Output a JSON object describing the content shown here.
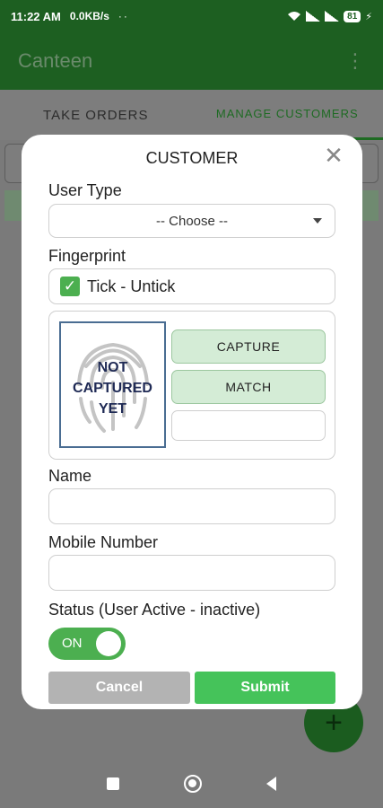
{
  "status_bar": {
    "time": "11:22 AM",
    "speed": "0.0KB/s",
    "dots": "··",
    "battery": "81"
  },
  "app_bar": {
    "title": "Canteen",
    "menu_icon": "more-vert-icon"
  },
  "tabs": [
    {
      "label": "TAKE ORDERS"
    },
    {
      "label": "MANAGE CUSTOMERS",
      "active": true
    }
  ],
  "dialog": {
    "title": "CUSTOMER",
    "close_icon": "close-icon",
    "user_type_label": "User Type",
    "user_type_value": "-- Choose --",
    "fingerprint_label": "Fingerprint",
    "tick_label": "Tick - Untick",
    "tick_checked": true,
    "fingerprint_status": [
      "NOT",
      "CAPTURED",
      "YET"
    ],
    "capture_label": "CAPTURE",
    "match_label": "MATCH",
    "match_result": "",
    "name_label": "Name",
    "name_value": "",
    "mobile_label": "Mobile Number",
    "mobile_value": "",
    "status_label": "Status (User Active - inactive)",
    "status_toggle": "ON",
    "cancel_label": "Cancel",
    "submit_label": "Submit"
  },
  "fab": {
    "icon": "plus-icon",
    "symbol": "+"
  },
  "colors": {
    "primary_dark": "#1d5f21",
    "accent_green": "#4caf50",
    "submit_green": "#45c35a",
    "capture_bg": "#d4ecd6",
    "cancel_gray": "#b3b3b3"
  }
}
